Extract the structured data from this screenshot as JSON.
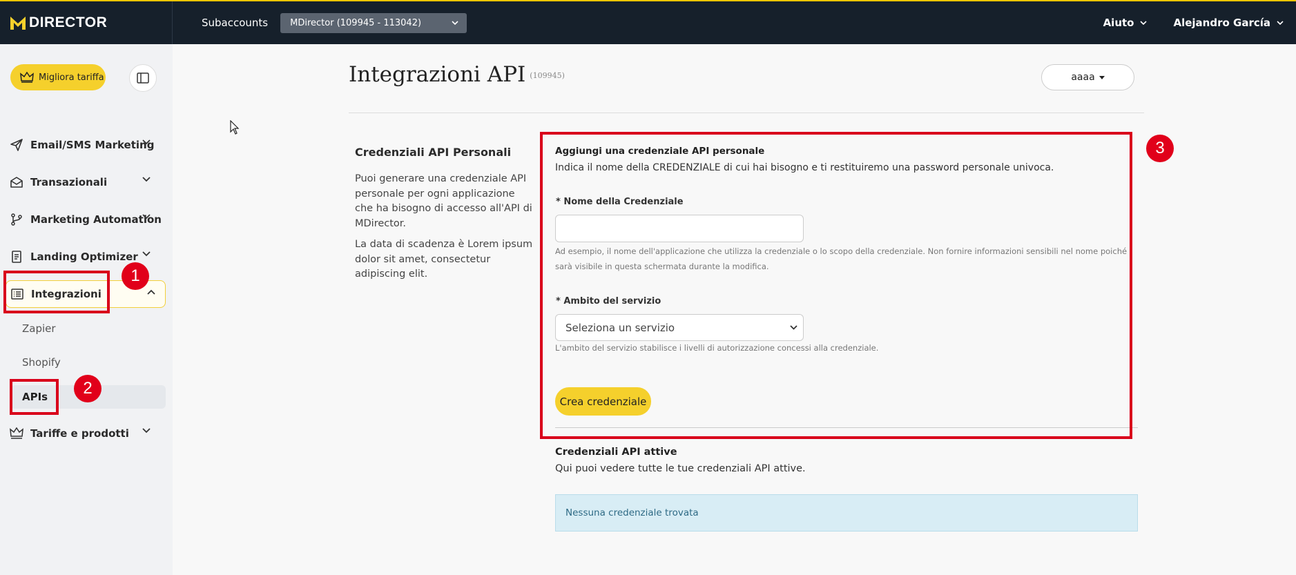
{
  "colors": {
    "topbar": "#16202b",
    "accent": "#f5d02c",
    "annotation_red": "#d9001b",
    "info_bg": "#d8edf5"
  },
  "header": {
    "logo_text": "DIRECTOR",
    "subaccounts_label": "Subaccounts",
    "subaccount_selected": "MDirector (109945 - 113042)",
    "help_label": "Aiuto",
    "user_name": "Alejandro García"
  },
  "sidebar": {
    "upgrade_label": "Migliora tariffa",
    "items": [
      {
        "label": "Email/SMS Marketing",
        "icon": "send-icon"
      },
      {
        "label": "Transazionali",
        "icon": "envelope-icon"
      },
      {
        "label": "Marketing Automation",
        "icon": "branch-icon"
      },
      {
        "label": "Landing Optimizer",
        "icon": "document-icon"
      },
      {
        "label": "Integrazioni",
        "icon": "list-icon"
      },
      {
        "label": "Tariffe e prodotti",
        "icon": "crown-icon"
      }
    ],
    "subitems": [
      {
        "label": "Zapier"
      },
      {
        "label": "Shopify"
      },
      {
        "label": "APIs"
      }
    ]
  },
  "annotations": {
    "badge1": "1",
    "badge2": "2",
    "badge3": "3"
  },
  "main": {
    "title": "Integrazioni API",
    "title_id": "(109945)",
    "account_button": "aaaa",
    "left": {
      "title": "Credenziali API Personali",
      "p1": "Puoi generare una credenziale API personale per ogni applicazione che ha bisogno di accesso all'API di MDirector.",
      "p2": "La data di scadenza è Lorem ipsum dolor sit amet, consectetur adipiscing elit."
    },
    "form": {
      "title": "Aggiungi una credenziale API personale",
      "description": "Indica il nome della CREDENZIALE di cui hai bisogno e ti restituiremo una password personale univoca.",
      "name_label": "* Nome della Credenziale",
      "name_value": "",
      "name_hint": "Ad esempio, il nome dell'applicazione che utilizza la credenziale o lo scopo della credenziale. Non fornire informazioni sensibili nel nome poiché sarà visibile in questa schermata durante la modifica.",
      "scope_label": "* Ambito del servizio",
      "scope_selected": "Seleziona un servizio",
      "scope_hint": "L'ambito del servizio stabilisce i livelli di autorizzazione concessi alla credenziale.",
      "submit_label": "Crea credenziale"
    },
    "active": {
      "title": "Credenziali API attive",
      "description": "Qui puoi vedere tutte le tue credenziali API attive.",
      "empty_message": "Nessuna credenziale trovata"
    }
  }
}
